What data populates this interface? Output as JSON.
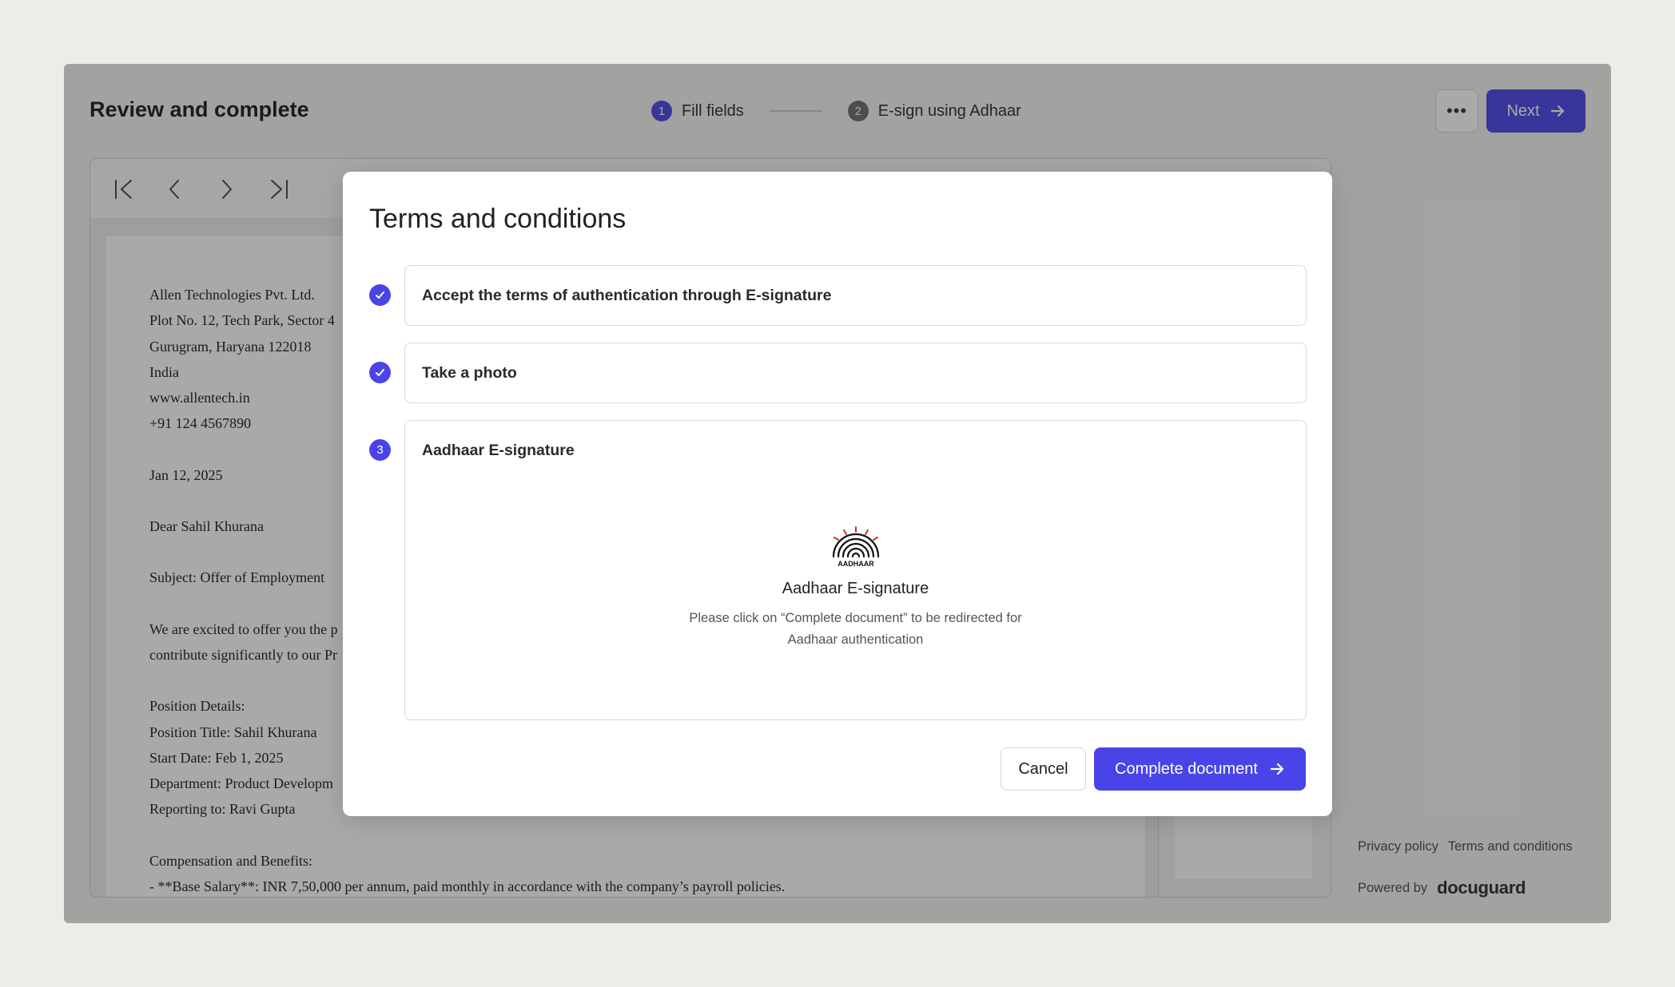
{
  "header": {
    "title": "Review and complete",
    "steps": [
      {
        "number": "1",
        "label": "Fill fields"
      },
      {
        "number": "2",
        "label": "E-sign using Adhaar"
      }
    ],
    "more_label": "•••",
    "next_label": "Next"
  },
  "document": {
    "lines": [
      "Allen Technologies Pvt. Ltd.",
      "Plot No. 12, Tech Park, Sector 4",
      "Gurugram, Haryana 122018",
      "India",
      "www.allentech.in",
      "+91 124 4567890",
      "Jan 12, 2025",
      "Dear Sahil Khurana",
      "Subject: Offer of Employment",
      "We are excited to offer you the p",
      "contribute significantly to our Pr",
      "Position Details:",
      "Position Title: Sahil Khurana",
      "Start Date: Feb 1, 2025",
      "Department: Product Developm",
      "Reporting to: Ravi Gupta",
      "Compensation and Benefits:",
      "- **Base Salary**: INR 7,50,000 per annum, paid monthly in accordance with the company’s payroll policies."
    ]
  },
  "footer": {
    "privacy": "Privacy policy",
    "terms": "Terms and conditions",
    "powered_by": "Powered by",
    "brand": "docuguard"
  },
  "modal": {
    "title": "Terms and conditions",
    "tasks": [
      {
        "label": "Accept the terms of authentication through E-signature"
      },
      {
        "label": "Take a photo"
      },
      {
        "number": "3",
        "label": "Aadhaar E-signature"
      }
    ],
    "aadhaar_logo_text": "AADHAAR",
    "aadhaar_title": "Aadhaar E-signature",
    "aadhaar_desc_line1": "Please click on “Complete document” to be redirected for",
    "aadhaar_desc_line2": "Aadhaar authentication",
    "cancel_label": "Cancel",
    "complete_label": "Complete document"
  },
  "colors": {
    "accent": "#4a44e8",
    "overlay": "rgba(30,30,30,0.38)"
  }
}
